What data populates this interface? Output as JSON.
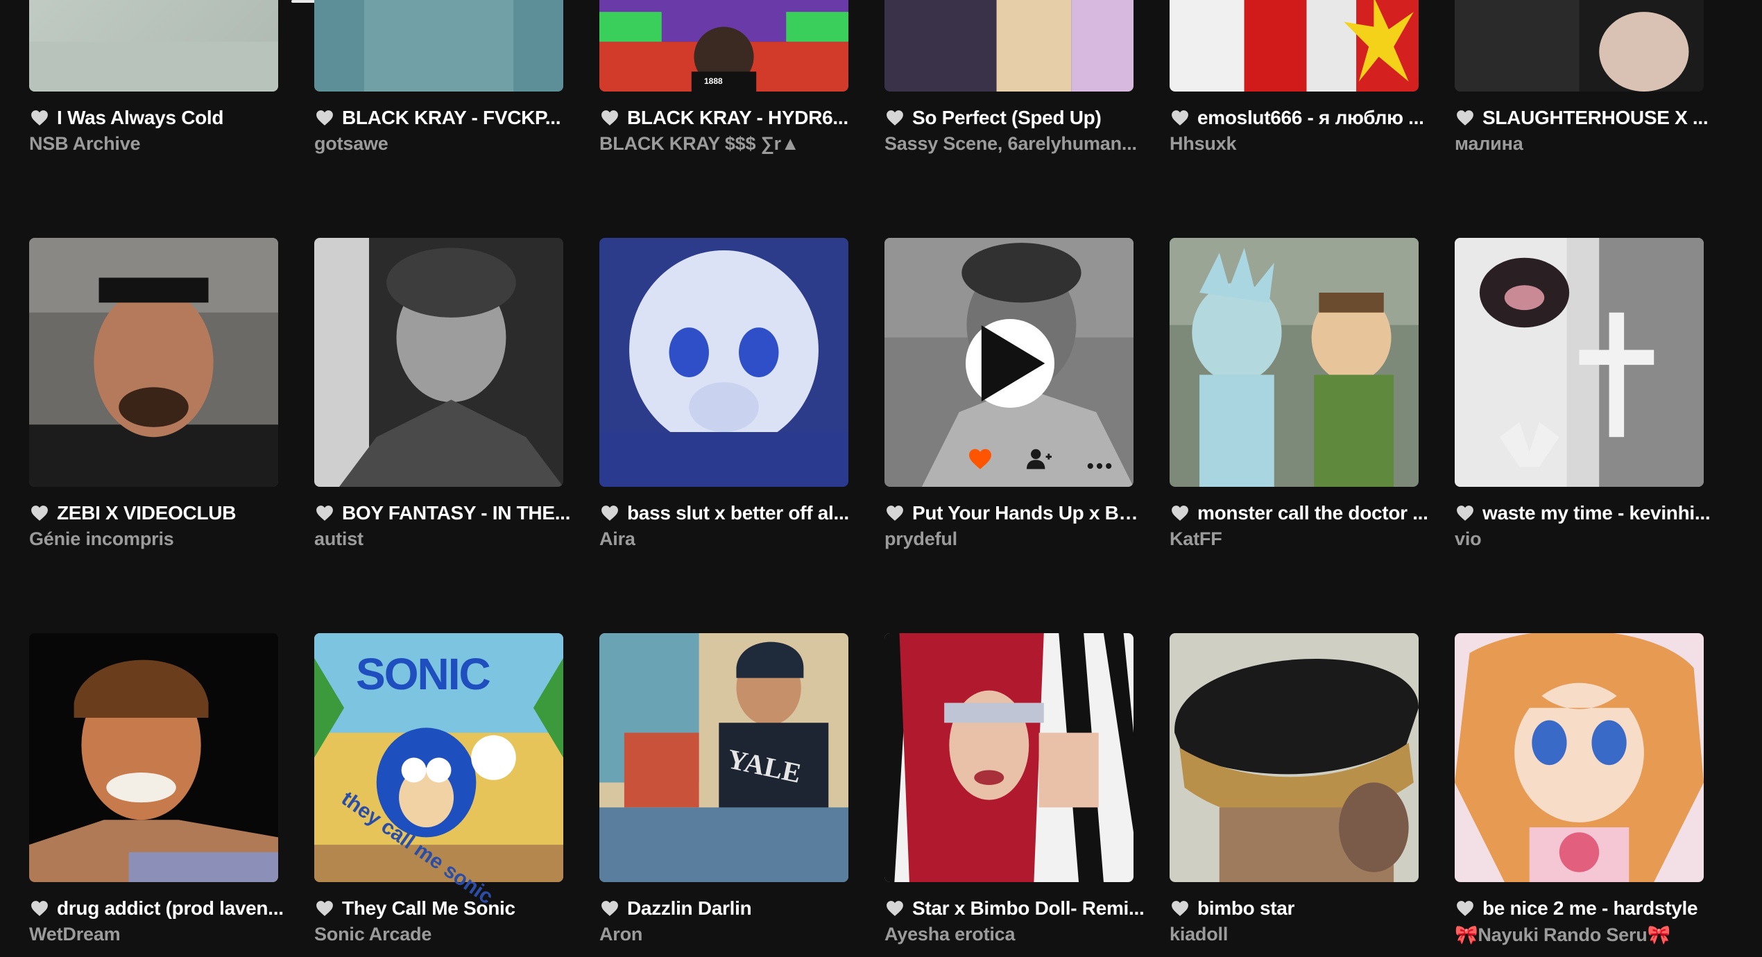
{
  "colors": {
    "background": "#111111",
    "title": "#ffffff",
    "subtitle": "#9b9b9b",
    "heart": "#d6d6d6",
    "heart_active": "#ff5500"
  },
  "tracks": [
    {
      "title": "I Was Always Cold",
      "artist": "NSB Archive",
      "icon": "heart-icon"
    },
    {
      "title": "BLACK KRAY - FVCKP...",
      "artist": "gotsawe",
      "icon": "heart-icon"
    },
    {
      "title": "BLACK KRAY - HYDR6...",
      "artist": "BLACK KRAY $$$ ∑r▲",
      "icon": "heart-icon",
      "art_text": "1888"
    },
    {
      "title": "So Perfect (Sped Up)",
      "artist": "Sassy Scene, 6arelyhuman...",
      "icon": "heart-icon"
    },
    {
      "title": "emoslut666 - я люблю ...",
      "artist": "Hhsuxk",
      "icon": "heart-icon"
    },
    {
      "title": "SLAUGHTERHOUSE X ...",
      "artist": "малина",
      "icon": "heart-icon"
    },
    {
      "title": "ZEBI X VIDEOCLUB",
      "artist": "Génie incompris",
      "icon": "heart-icon"
    },
    {
      "title": "BOY FANTASY - IN THE...",
      "artist": "autist",
      "icon": "heart-icon"
    },
    {
      "title": "bass slut x better off al...",
      "artist": "Aira",
      "icon": "heart-icon"
    },
    {
      "title": "Put Your Hands Up x Be...",
      "artist": "prydeful",
      "icon": "heart-icon",
      "hovered": true
    },
    {
      "title": "monster call the doctor ...",
      "artist": "KatFF",
      "icon": "heart-icon"
    },
    {
      "title": "waste my time - kevinhi...",
      "artist": "vio",
      "icon": "heart-icon"
    },
    {
      "title": "drug addict (prod laven...",
      "artist": "WetDream",
      "icon": "heart-icon"
    },
    {
      "title": "They Call Me Sonic",
      "artist": "Sonic Arcade",
      "icon": "heart-icon",
      "art_text": [
        "SONIC",
        "they call me sonic"
      ]
    },
    {
      "title": "Dazzlin Darlin",
      "artist": "Aron",
      "icon": "heart-icon",
      "art_text": "YALE"
    },
    {
      "title": "Star x Bimbo Doll- Remi...",
      "artist": "Ayesha erotica",
      "icon": "heart-icon"
    },
    {
      "title": "bimbo star",
      "artist": "kiadoll",
      "icon": "heart-icon"
    },
    {
      "title": "be nice 2 me - hardstyle",
      "artist": "🎀Nayuki Rando Seru🎀",
      "icon": "heart-icon"
    }
  ],
  "hover_actions": [
    {
      "icon": "heart-filled-icon"
    },
    {
      "icon": "follow-user-icon"
    },
    {
      "icon": "more-options-icon"
    }
  ]
}
